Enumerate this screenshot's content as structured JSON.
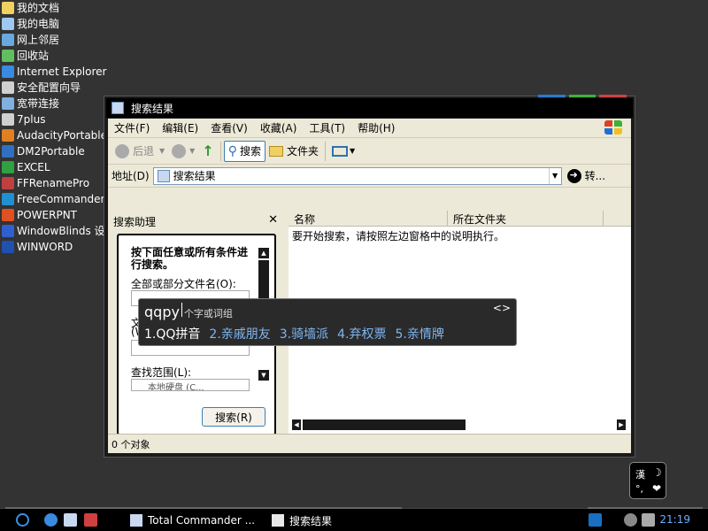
{
  "desktop": {
    "icons": [
      {
        "label": "我的文档",
        "icon": "my-documents-icon",
        "color": "#f0d060"
      },
      {
        "label": "我的电脑",
        "icon": "my-computer-icon",
        "color": "#9ec8f0"
      },
      {
        "label": "网上邻居",
        "icon": "network-icon",
        "color": "#6aa8e0"
      },
      {
        "label": "回收站",
        "icon": "recycle-bin-icon",
        "color": "#60c060"
      },
      {
        "label": "Internet Explorer",
        "icon": "ie-icon",
        "color": "#3a8ae0"
      },
      {
        "label": "安全配置向导",
        "icon": "security-wizard-icon",
        "color": "#d0d0d0"
      },
      {
        "label": "宽带连接",
        "icon": "broadband-icon",
        "color": "#80b0e0"
      },
      {
        "label": "7plus",
        "icon": "app-icon",
        "color": "#d0d0d0"
      },
      {
        "label": "AudacityPortable",
        "icon": "audacity-icon",
        "color": "#e08020"
      },
      {
        "label": "DM2Portable",
        "icon": "dm2-icon",
        "color": "#3070c0"
      },
      {
        "label": "EXCEL",
        "icon": "excel-icon",
        "color": "#30a040"
      },
      {
        "label": "FFRenamePro",
        "icon": "ffrename-icon",
        "color": "#c04040"
      },
      {
        "label": "FreeCommander",
        "icon": "freecommander-icon",
        "color": "#2090d0"
      },
      {
        "label": "POWERPNT",
        "icon": "powerpoint-icon",
        "color": "#e05020"
      },
      {
        "label": "WindowBlinds 设",
        "icon": "windowblinds-icon",
        "color": "#3060d0"
      },
      {
        "label": "WINWORD",
        "icon": "word-icon",
        "color": "#2050b0"
      }
    ]
  },
  "window": {
    "title": "搜索结果",
    "menu": [
      "文件(F)",
      "编辑(E)",
      "查看(V)",
      "收藏(A)",
      "工具(T)",
      "帮助(H)"
    ],
    "toolbar": {
      "back": "后退",
      "search": "搜索",
      "folders": "文件夹"
    },
    "address": {
      "label": "地址(D)",
      "value": "搜索结果",
      "go": "转..."
    },
    "search_pane": {
      "title": "搜索助理",
      "close": "✕",
      "heading": "按下面任意或所有条件进行搜索。",
      "filename_label": "全部或部分文件名(O):",
      "word_label_1": "文",
      "word_label_2": "(W",
      "scope_label": "查找范围(L):",
      "scope_value": "本地硬盘 (C...",
      "search_button": "搜索(R)"
    },
    "columns": [
      "名称",
      "所在文件夹"
    ],
    "hint": "要开始搜索，请按照左边窗格中的说明执行。",
    "status": "0 个对象"
  },
  "ime": {
    "typed": "qqpy",
    "hint": "个字或词组",
    "arrows": "<>",
    "candidates": [
      "1.QQ拼音",
      "2.亲戚朋友",
      "3.骑墙派",
      "4.弃权票",
      "5.亲情牌"
    ]
  },
  "lang_widget": {
    "han": "漢",
    "moon": "☽",
    "punct": "°,",
    "heart": "❤"
  },
  "taskbar": {
    "tasks": [
      "Total Commander ...",
      "搜索结果"
    ],
    "clock": "21:19"
  },
  "colors": {
    "desktop": "#333333",
    "link_blue": "#7eb6f2",
    "clock": "#6ab0ff"
  }
}
